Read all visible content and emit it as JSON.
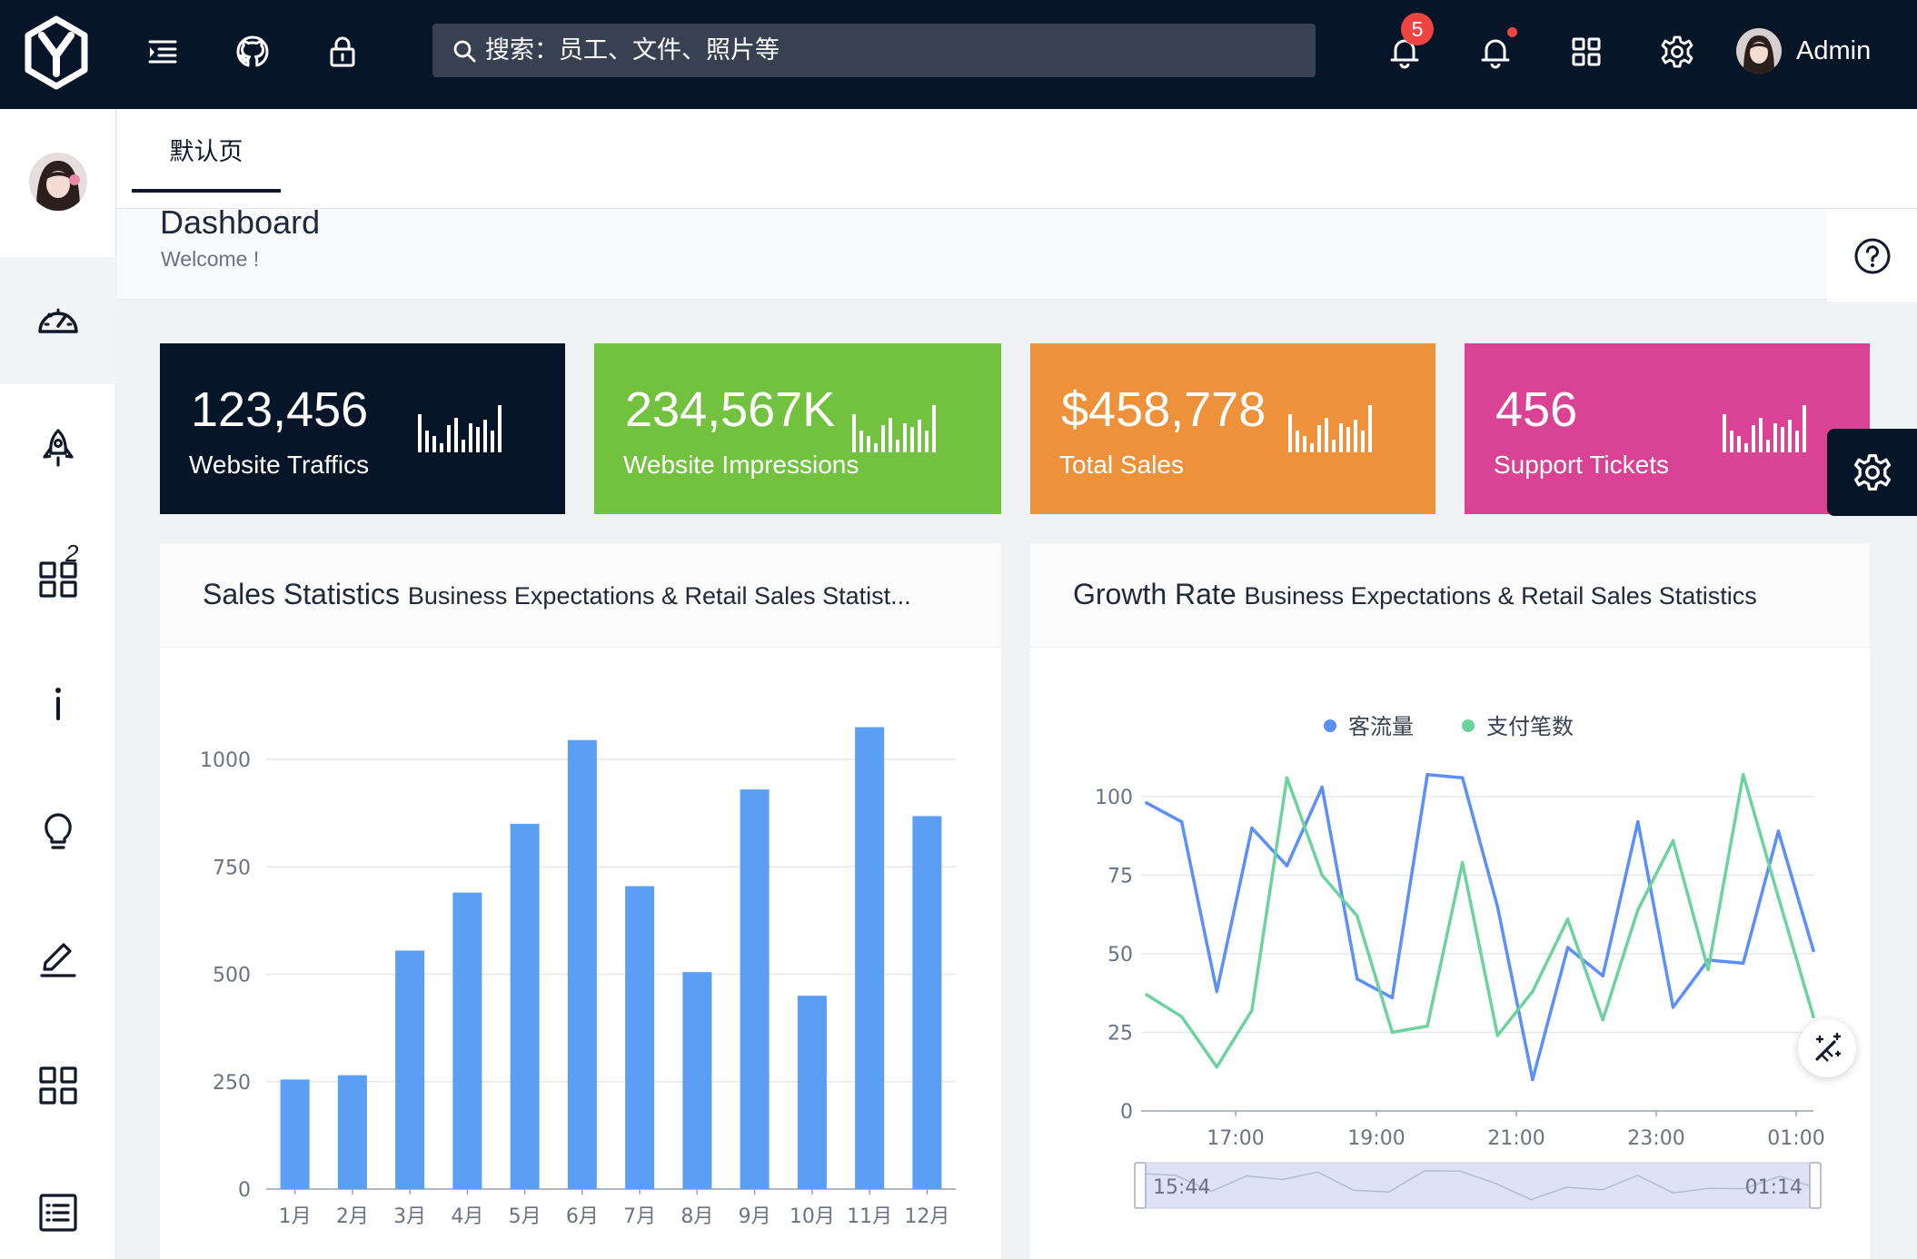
{
  "topbar": {
    "search_placeholder": "搜索：员工、文件、照片等",
    "notification_count": "5",
    "user_name": "Admin",
    "icons": [
      "logo-icon",
      "menu-fold-icon",
      "github-icon",
      "lock-icon",
      "search-icon",
      "bell-icon",
      "bell-icon",
      "apps-grid-icon",
      "gear-icon",
      "avatar"
    ]
  },
  "sidebar": {
    "items": [
      {
        "icon": "dashboard-icon",
        "active": true
      },
      {
        "icon": "rocket-icon"
      },
      {
        "icon": "grid-icon",
        "superscript": "2"
      },
      {
        "icon": "info-icon"
      },
      {
        "icon": "lightbulb-icon"
      },
      {
        "icon": "pencil-icon"
      },
      {
        "icon": "grid-icon"
      },
      {
        "icon": "list-icon"
      }
    ]
  },
  "tabs": [
    {
      "label": "默认页"
    }
  ],
  "page": {
    "title": "Dashboard",
    "subtitle": "Welcome !"
  },
  "stats": [
    {
      "value": "123,456",
      "label": "Website Traffics",
      "color": "#061527"
    },
    {
      "value": "234,567K",
      "label": "Website Impressions",
      "color": "#72c240"
    },
    {
      "value": "$458,778",
      "label": "Total Sales",
      "color": "#ed913a"
    },
    {
      "value": "456",
      "label": "Support Tickets",
      "color": "#da4393"
    }
  ],
  "panels": {
    "sales": {
      "title": "Sales Statistics",
      "subtitle": "Business Expectations & Retail Sales Statist..."
    },
    "growth": {
      "title": "Growth Rate",
      "subtitle": "Business Expectations & Retail Sales Statistics"
    }
  },
  "chart_data": [
    {
      "type": "bar",
      "categories": [
        "1月",
        "2月",
        "3月",
        "4月",
        "5月",
        "6月",
        "7月",
        "8月",
        "9月",
        "10月",
        "11月",
        "12月"
      ],
      "values": [
        255,
        265,
        555,
        690,
        850,
        1045,
        705,
        505,
        930,
        450,
        1075,
        868
      ],
      "yticks": [
        0,
        250,
        500,
        750,
        1000
      ],
      "ylim": [
        0,
        1100
      ],
      "grid": true,
      "color": "#5b9ff4"
    },
    {
      "type": "line",
      "x_ticks": [
        "17:00",
        "19:00",
        "21:00",
        "23:00",
        "01:00"
      ],
      "yticks": [
        0,
        25,
        50,
        75,
        100
      ],
      "ylim": [
        0,
        110
      ],
      "legend_position": "top-center",
      "series": [
        {
          "name": "客流量",
          "color": "#5b8ff9",
          "values": [
            98,
            92,
            38,
            90,
            78,
            103,
            42,
            36,
            107,
            106,
            65,
            10,
            52,
            43,
            92,
            33,
            48,
            47,
            89,
            51
          ]
        },
        {
          "name": "支付笔数",
          "color": "#6dd39e",
          "values": [
            37,
            30,
            14,
            32,
            106,
            75,
            62,
            25,
            27,
            79,
            24,
            38,
            61,
            29,
            64,
            86,
            45,
            107,
            68,
            30
          ]
        }
      ],
      "dataZoom": {
        "start_label": "15:44",
        "end_label": "01:14"
      }
    }
  ]
}
